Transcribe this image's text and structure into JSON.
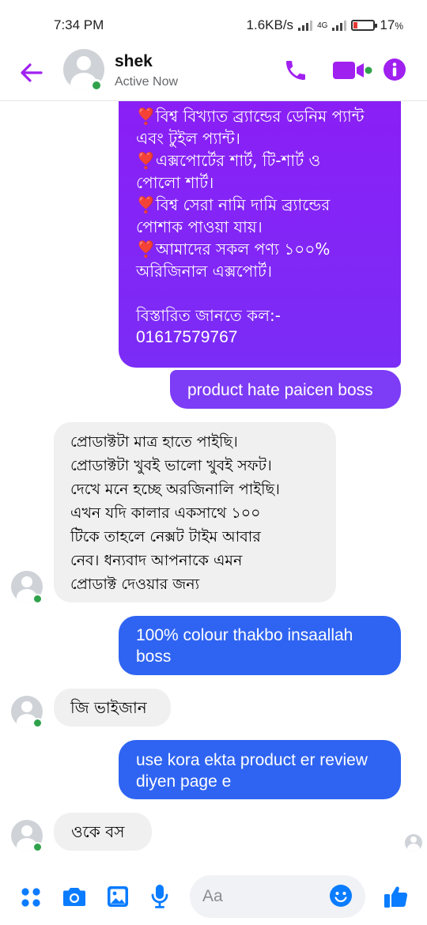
{
  "status_bar": {
    "time": "7:34 PM",
    "network_speed": "1.6KB/s",
    "network_type": "4G",
    "battery": "17",
    "battery_unit": "%"
  },
  "header": {
    "contact_name": "shek",
    "contact_status": "Active Now",
    "accent_color": "#a020f0",
    "icons": [
      "back-arrow-icon",
      "phone-icon",
      "video-camera-icon",
      "info-icon"
    ]
  },
  "messages": [
    {
      "sender": "me",
      "lines": [
        "বিশ্ব বিখ্যাত ব্র্যান্ডের ডেনিম প্যান্ট",
        "এবং টুইল প্যান্ট।",
        "এক্সপোর্টের শার্ট, টি-শার্ট ও",
        "পোলো শার্ট।",
        "বিশ্ব সেরা নামি দামি ব্র্যান্ডের",
        "পোশাক পাওয়া যায়।",
        "আমাদের সকল পণ্য ১০০%",
        "অরিজিনাল এক্সপোর্ট।",
        "",
        "বিস্তারিত জানতে কল:-",
        "01617579767"
      ],
      "heart_emoji": "❣️"
    },
    {
      "sender": "me",
      "text": "product hate paicen boss"
    },
    {
      "sender": "shek",
      "lines": [
        "প্রোডাক্টটা মাত্র হাতে পাইছি।",
        "প্রোডাক্টটা খুবই ভালো খুবই সফট।",
        "দেখে মনে হচ্ছে অরজিনালি পাইছি।",
        "এখন যদি কালার একসাথে ১০০",
        "টিকে তাহলে নেক্সট টাইম আবার",
        "নেব। ধন্যবাদ আপনাকে এমন",
        "প্রোডাক্ট দেওয়ার জন্য"
      ]
    },
    {
      "sender": "me",
      "lines": [
        "100% colour thakbo insaallah",
        "boss"
      ]
    },
    {
      "sender": "shek",
      "text": "জি ভাইজান"
    },
    {
      "sender": "me",
      "lines": [
        "use kora ekta product er review",
        "diyen page e"
      ]
    },
    {
      "sender": "shek",
      "text": "ওকে বস"
    }
  ],
  "composer": {
    "placeholder": "Aa",
    "icons": [
      "apps-menu-icon",
      "camera-icon",
      "gallery-icon",
      "microphone-icon",
      "emoji-icon",
      "like-thumb-icon"
    ],
    "button_color": "#0a7cff"
  }
}
